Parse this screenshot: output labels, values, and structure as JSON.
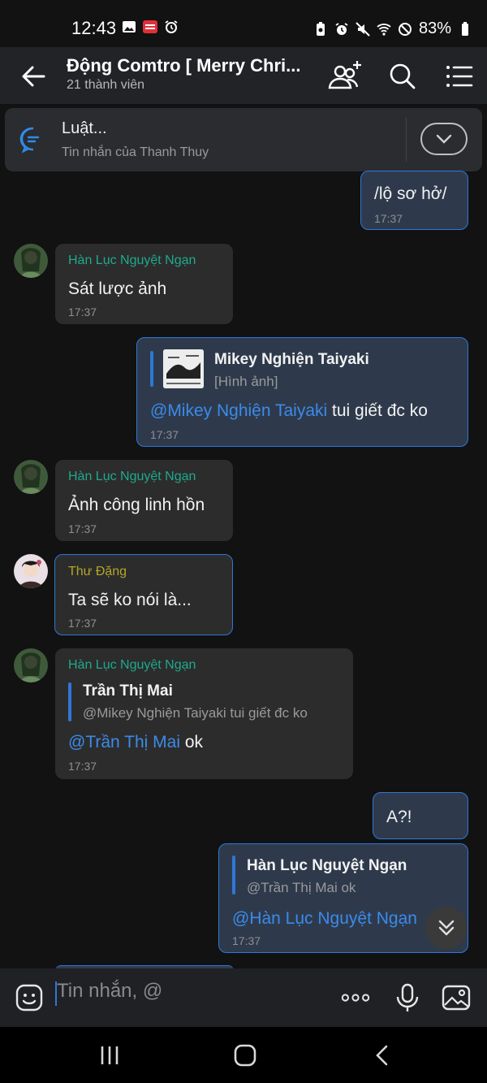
{
  "status_bar": {
    "time": "12:43",
    "battery": "83%"
  },
  "header": {
    "title": "Động Comtro [ Merry Chri...",
    "subtitle": "21 thành viên"
  },
  "pinned": {
    "title": "Luật...",
    "subtitle": "Tin nhắn của Thanh Thuy"
  },
  "messages": [
    {
      "text": "/lộ sơ hở/",
      "time": "17:37"
    },
    {
      "sender": "Hàn Lục Nguyệt Ngạn",
      "text": "Sát lược ảnh",
      "time": "17:37"
    },
    {
      "quote_name": "Mikey Nghiện Taiyaki",
      "quote_text": "[Hình ảnh]",
      "mention": "@Mikey Nghiện Taiyaki",
      "text": " tui giết đc ko",
      "time": "17:37"
    },
    {
      "sender": "Hàn Lục Nguyệt Ngạn",
      "text": "Ảnh công linh hồn",
      "time": "17:37"
    },
    {
      "sender": "Thư Đặng",
      "text": "Ta sẽ ko nói là...",
      "time": "17:37"
    },
    {
      "sender": "Hàn Lục Nguyệt Ngạn",
      "quote_name": "Trần Thị Mai",
      "quote_text": "@Mikey Nghiện Taiyaki tui giết đc ko",
      "mention": "@Trần Thị Mai",
      "text": " ok",
      "time": "17:37"
    },
    {
      "text": "A?!"
    },
    {
      "quote_name": "Hàn Lục Nguyệt Ngạn",
      "quote_text": "@Trần Thị Mai ok",
      "mention": "@Hàn Lục Nguyệt Ngạn",
      "time": "17:37"
    }
  ],
  "input": {
    "placeholder": "Tin nhắn, @"
  },
  "colors": {
    "accent": "#2f77d6",
    "sender_teal": "#1fa98e",
    "sender_olive": "#b3a52a"
  }
}
